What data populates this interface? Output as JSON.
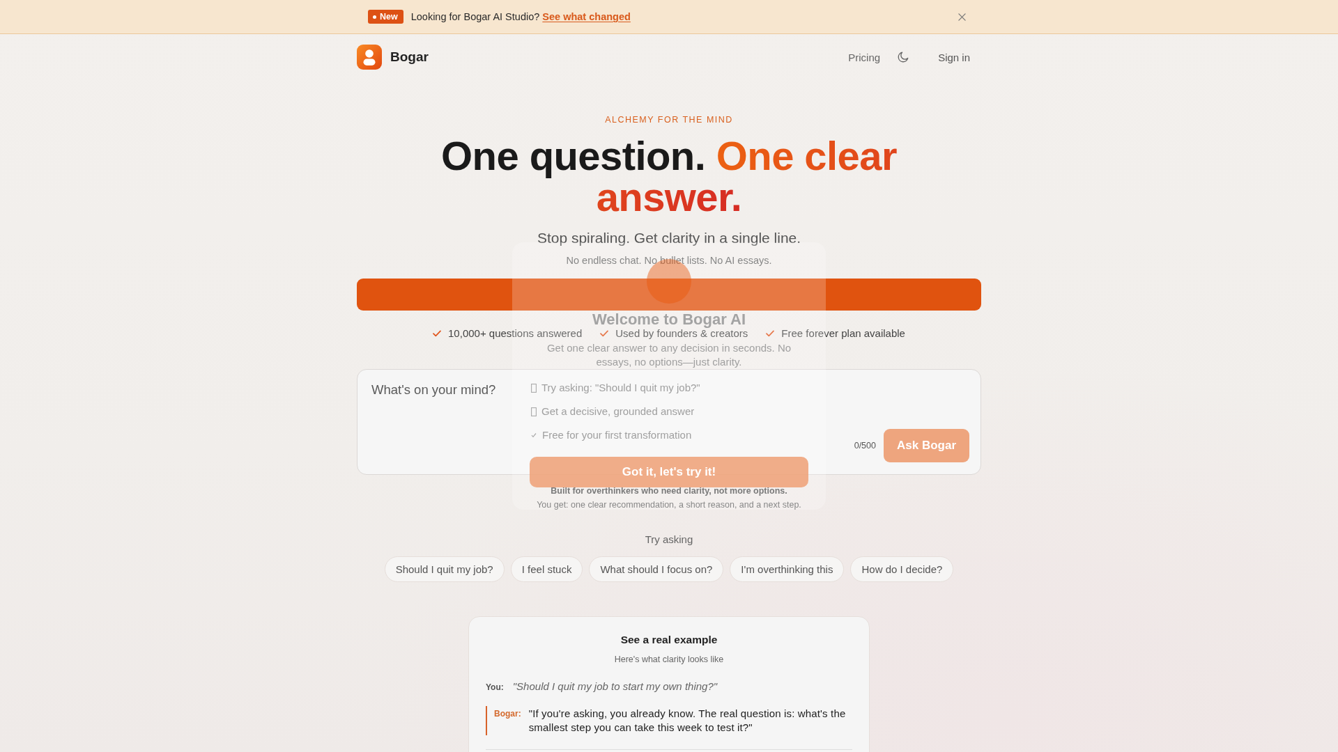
{
  "announcement": {
    "badge": "New",
    "text": "Looking for Bogar AI Studio?",
    "link": "See what changed"
  },
  "nav": {
    "brand": "Bogar",
    "pricing": "Pricing",
    "sign_in": "Sign in"
  },
  "hero": {
    "eyebrow": "ALCHEMY FOR THE MIND",
    "headline": {
      "lead": "One question.",
      "accent": "One clear answer."
    },
    "subtitle": "Stop spiraling. Get clarity in a single line.",
    "tagline": "No endless chat. No bullet lists. No AI essays."
  },
  "proof_points": [
    "10,000+ questions answered",
    "Used by founders & creators",
    "Free forever plan available"
  ],
  "question_box": {
    "placeholder": "What's on your mind?",
    "counter": "0/500",
    "submit": {
      "label": "Ask Bogar",
      "disabled": true
    }
  },
  "note": "Built for overthinkers who need clarity, not more options.",
  "detail": "You get: one clear recommendation, a short reason, and a next step.",
  "suggestions": {
    "label": "Try asking",
    "chips": [
      "Should I quit my job?",
      "I feel stuck",
      "What should I focus on?",
      "I'm overthinking this",
      "How do I decide?"
    ]
  },
  "example": {
    "title": "See a real example",
    "subtitle": "Here's what clarity looks like",
    "question": {
      "speaker": "You:",
      "text": "\"Should I quit my job to start my own thing?\""
    },
    "answer": {
      "speaker": "Bogar:",
      "text": "\"If you're asking, you already know. The real question is: what's the smallest step you can take this week to test it?\""
    }
  },
  "welcome_dialog": {
    "title": "Welcome to Bogar AI",
    "description": "Get one clear answer to any decision in seconds. No essays, no options—just clarity.",
    "items": [
      {
        "kind": "glyph",
        "text": "Try asking: \"Should I quit my job?\""
      },
      {
        "kind": "glyph",
        "text": "Get a decisive, grounded answer"
      },
      {
        "kind": "check",
        "text": "Free for your first transformation"
      }
    ],
    "button": "Got it, let's try it!"
  }
}
